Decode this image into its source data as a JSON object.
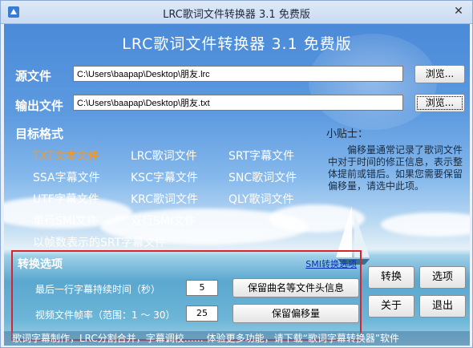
{
  "window": {
    "title": "LRC歌词文件转换器 3.1 免费版",
    "close_glyph": "✕"
  },
  "header": {
    "title": "LRC歌词文件转换器  3.1  免费版"
  },
  "source": {
    "label": "源文件",
    "path": "C:\\Users\\baapap\\Desktop\\朋友.lrc",
    "browse": "浏览..."
  },
  "output": {
    "label": "输出文件",
    "path": "C:\\Users\\baapap\\Desktop\\朋友.txt",
    "browse": "浏览..."
  },
  "formats": {
    "label": "目标格式",
    "items": [
      "TXT文本文件",
      "LRC歌词文件",
      "SRT字幕文件",
      "SSA字幕文件",
      "KSC字幕文件",
      "SNC歌词文件",
      "UTF字幕文件",
      "KRC歌词文件",
      "QLY歌词文件",
      "单行SMI文件",
      "双行SMI文件",
      "以帧数表示的SRT字幕文件"
    ],
    "selected": "TXT文本文件",
    "selected_color": "#f39a2d"
  },
  "tips": {
    "title": "小贴士：",
    "body": "偏移量通常记录了歌词文件中对于时间的修正信息，表示整体提前或错后。如果您需要保留偏移量，请选中此项。"
  },
  "options": {
    "title": "转换选项",
    "smi_link": "SMI转换选项",
    "last_line_label": "最后一行字幕持续时间（秒）",
    "last_line_value": "5",
    "keep_title_button": "保留曲名等文件头信息",
    "fps_label": "视频文件帧率（范围：1 ～ 30）",
    "fps_value": "25",
    "keep_offset_button": "保留偏移量",
    "border_color": "#d9232d"
  },
  "actions": {
    "convert": "转换",
    "options": "选项",
    "about": "关于",
    "exit": "退出"
  },
  "statusbar": {
    "text": "歌词字幕制作，LRC分割合并，字幕调校……  体验更多功能，请下载“歌词字幕转换器”软件"
  }
}
